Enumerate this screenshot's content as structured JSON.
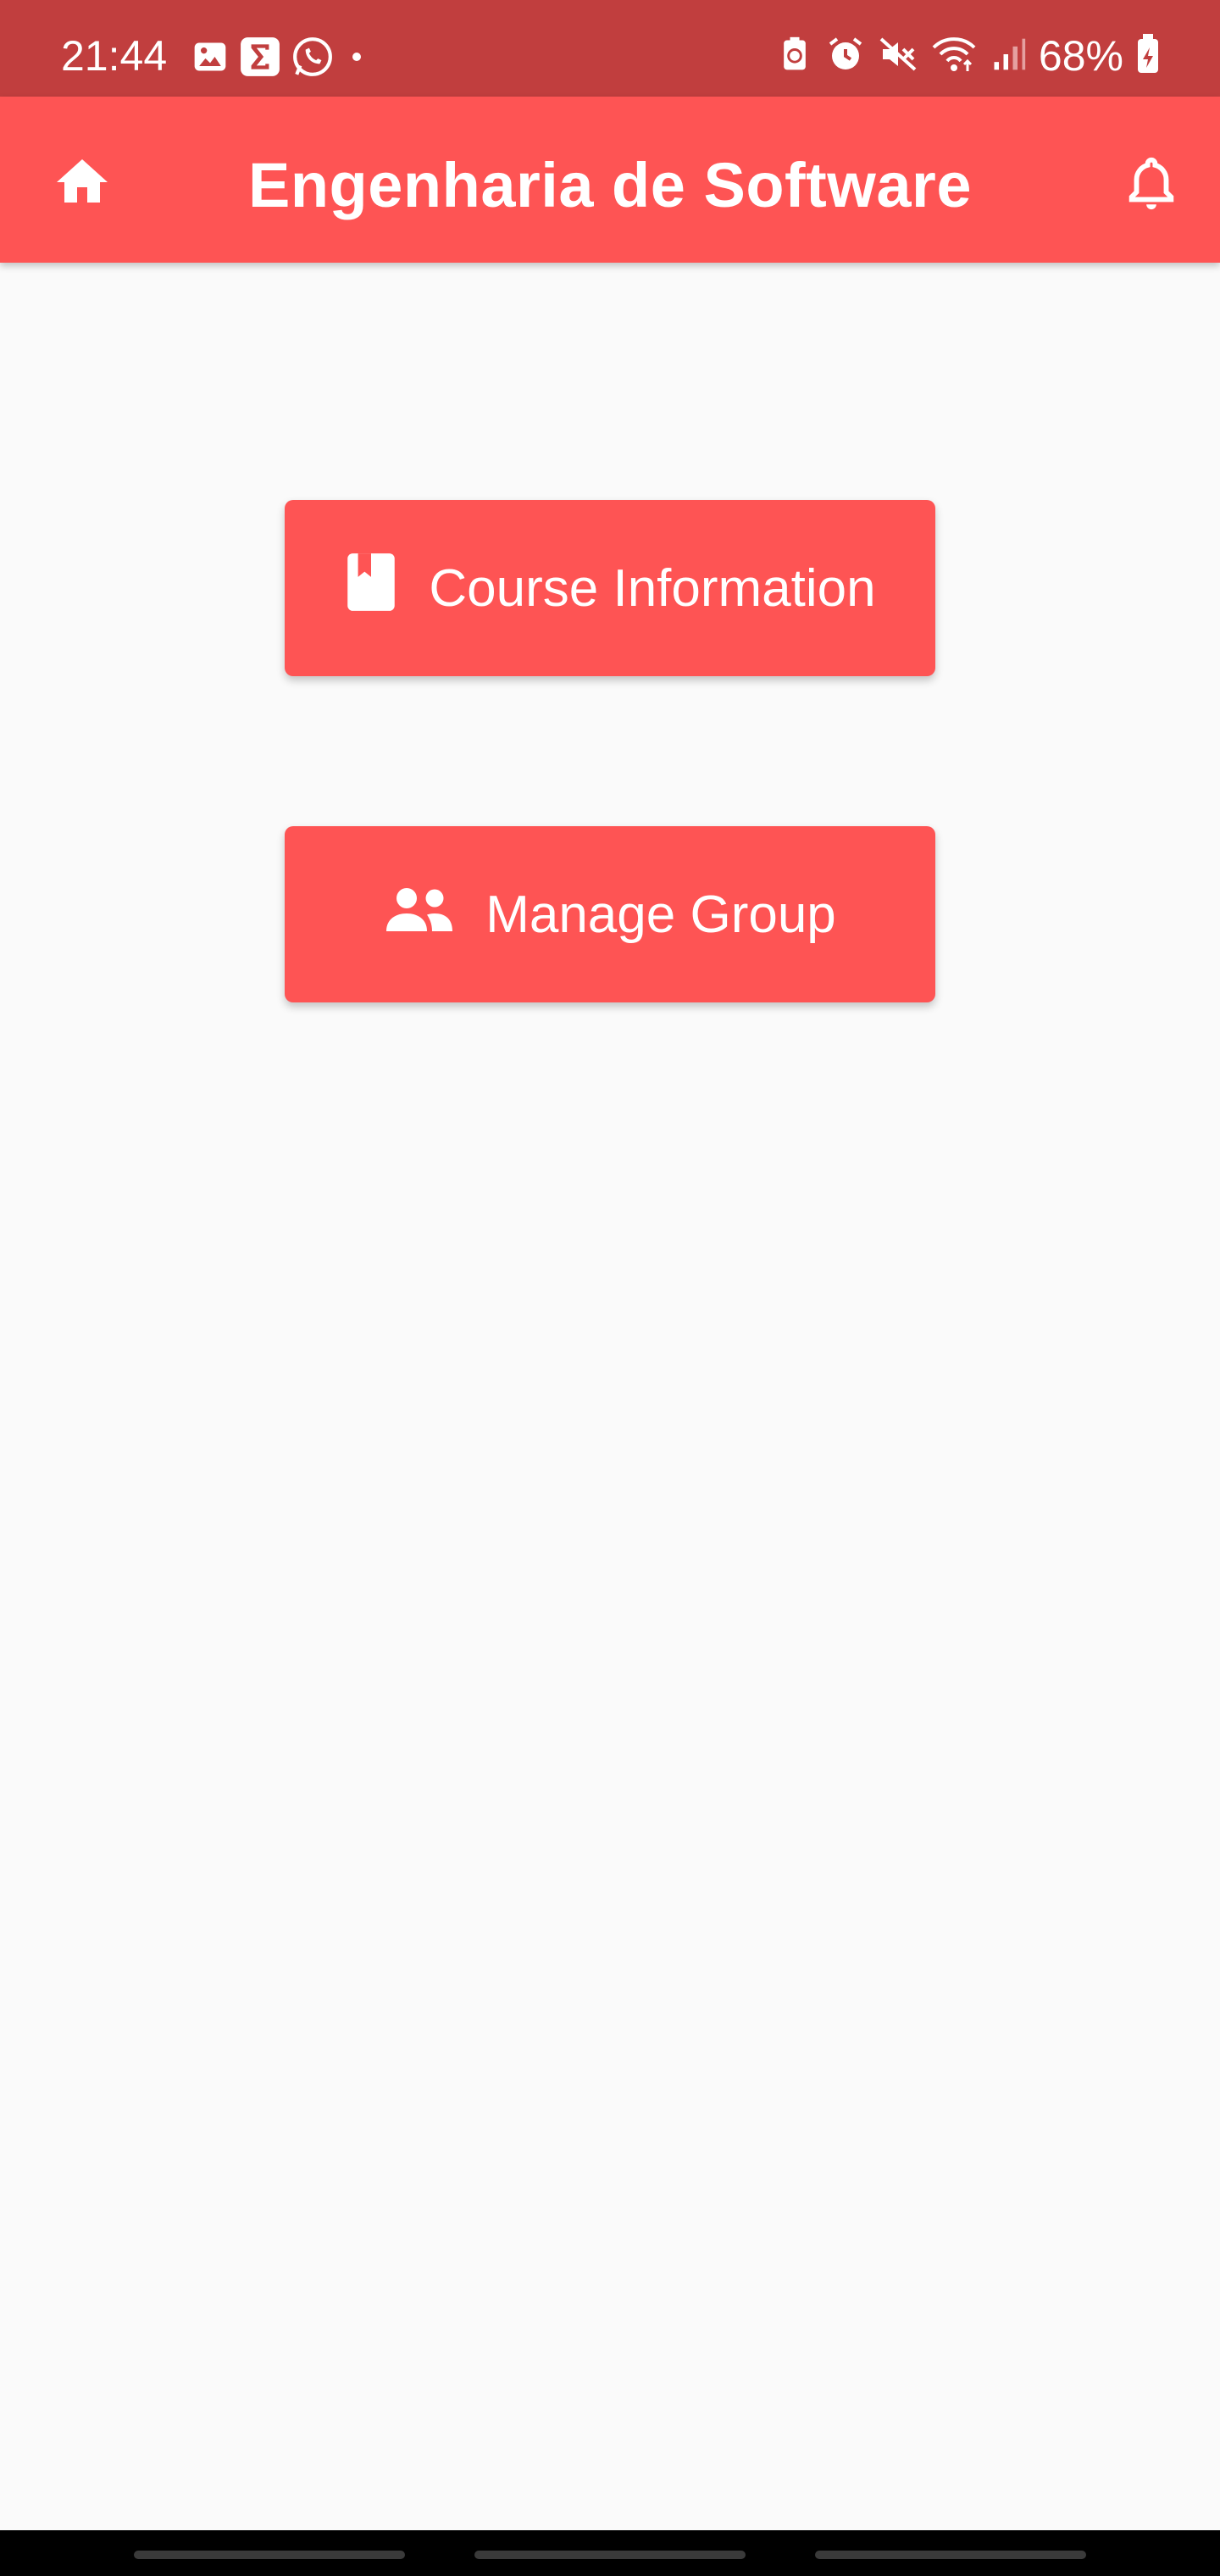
{
  "status_bar": {
    "time": "21:44",
    "battery_percent": "68%",
    "left_icons": [
      "gallery-icon",
      "sigma-app-icon",
      "whatsapp-icon",
      "dot-icon"
    ],
    "right_icons": [
      "battery-saver-icon",
      "alarm-icon",
      "mute-icon",
      "wifi-icon",
      "signal-icon",
      "battery-icon"
    ]
  },
  "app_bar": {
    "title": "Engenharia de Software",
    "left_icon": "home-icon",
    "right_icon": "bell-icon"
  },
  "actions": {
    "course_info_label": "Course Information",
    "course_info_icon": "book-icon",
    "manage_group_label": "Manage Group",
    "manage_group_icon": "group-icon"
  },
  "colors": {
    "status_bar": "#c13e3e",
    "accent": "#fe5454",
    "background": "#fafafa"
  }
}
